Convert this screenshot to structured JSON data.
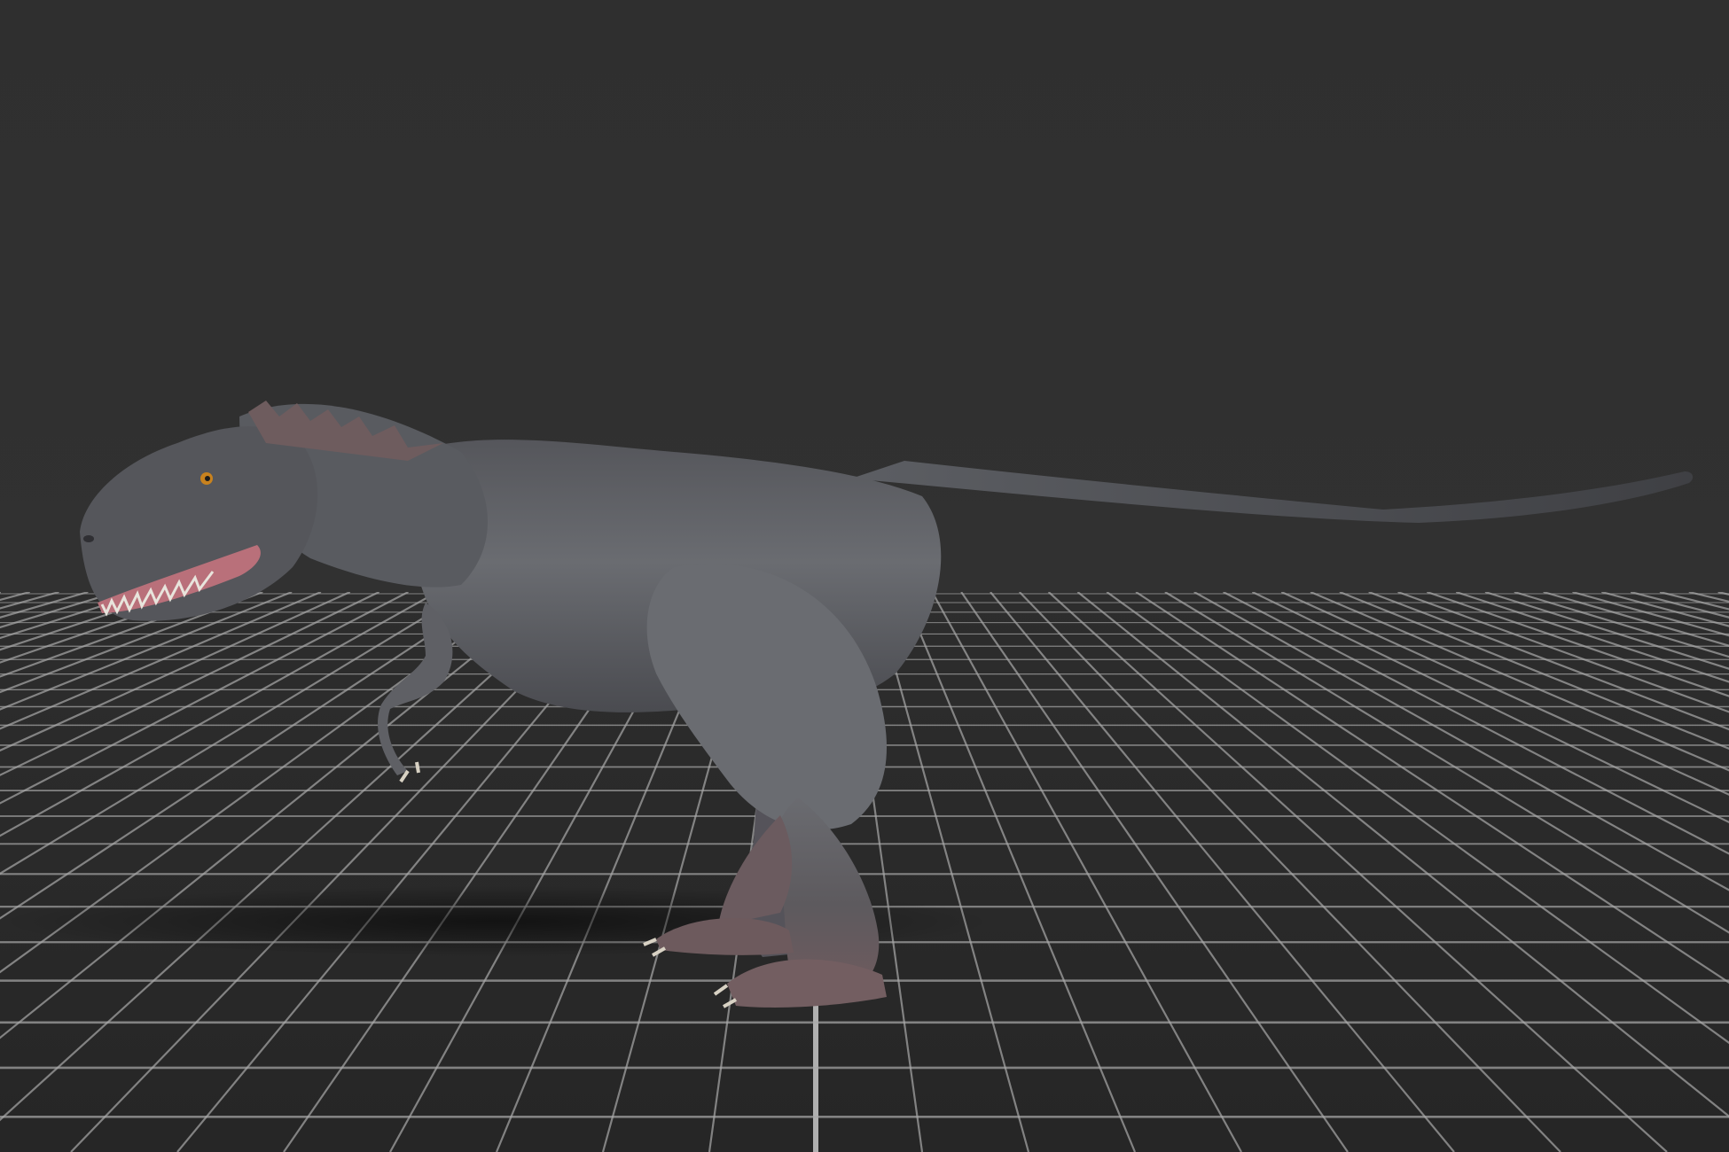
{
  "viewport": {
    "kind": "3d-model-preview",
    "model": "tyrannosaurus-rex",
    "background_color": "#2f2f2f",
    "floor_color": "#2c2c2c",
    "grid_color": "#a9a9a9",
    "grid_axis_color": "#c8c8c8",
    "model_body_color": "#5e6064",
    "model_dark_color": "#3e3f43",
    "model_feet_color": "#6b5a5c",
    "model_mouth_color": "#b9707a",
    "model_eye_color": "#c8821e"
  }
}
